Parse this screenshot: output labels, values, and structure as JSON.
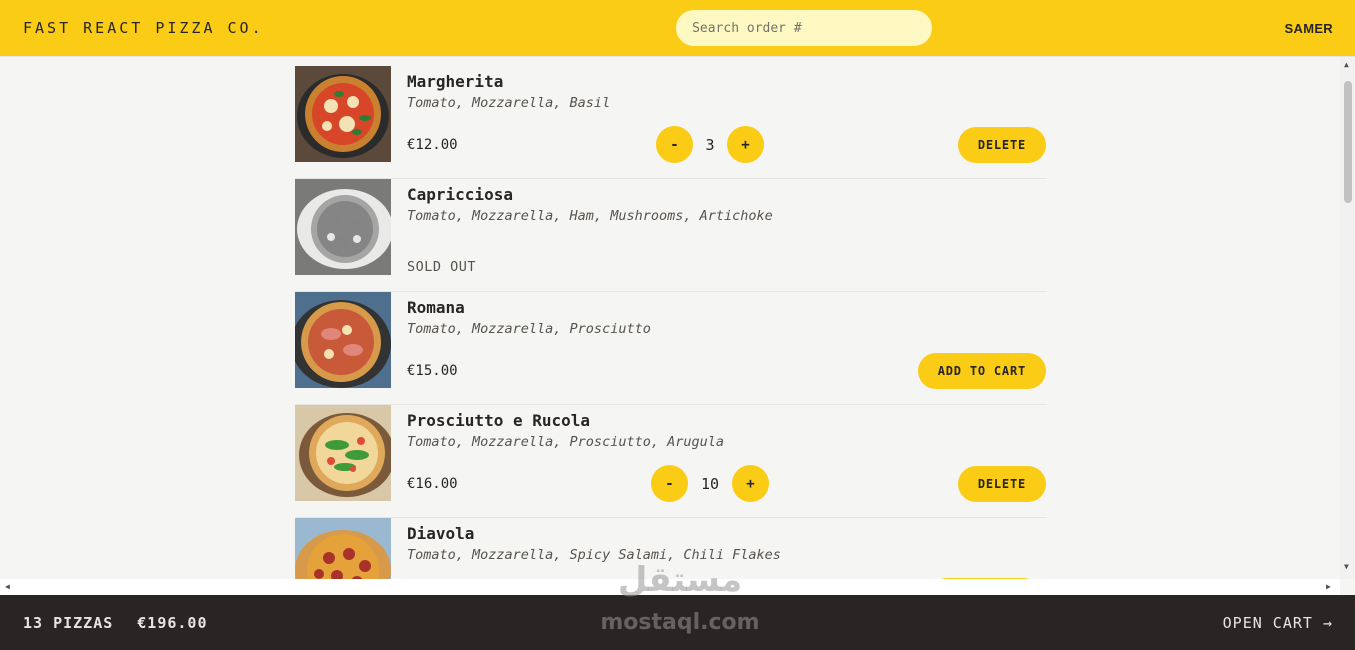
{
  "header": {
    "logo": "Fast React Pizza Co.",
    "search_placeholder": "Search order #",
    "username": "SAMER"
  },
  "menu": [
    {
      "name": "Margherita",
      "ingredients": "Tomato, Mozzarella, Basil",
      "price": "€12.00",
      "quantity": "3",
      "decrease_label": "-",
      "increase_label": "+",
      "action_label": "Delete",
      "sold_out": false
    },
    {
      "name": "Capricciosa",
      "ingredients": "Tomato, Mozzarella, Ham, Mushrooms, Artichoke",
      "status": "Sold out",
      "sold_out": true
    },
    {
      "name": "Romana",
      "ingredients": "Tomato, Mozzarella, Prosciutto",
      "price": "€15.00",
      "action_label": "Add to cart",
      "sold_out": false
    },
    {
      "name": "Prosciutto e Rucola",
      "ingredients": "Tomato, Mozzarella, Prosciutto, Arugula",
      "price": "€16.00",
      "quantity": "10",
      "decrease_label": "-",
      "increase_label": "+",
      "action_label": "Delete",
      "sold_out": false
    },
    {
      "name": "Diavola",
      "ingredients": "Tomato, Mozzarella, Spicy Salami, Chili Flakes",
      "sold_out": false
    }
  ],
  "footer": {
    "pizza_count": "13 pizzas",
    "total": "€196.00",
    "open_cart": "Open cart →"
  },
  "watermark": {
    "arabic": "مستقل",
    "latin": "mostaql.com"
  },
  "colors": {
    "brand_yellow": "#facc15",
    "search_bg": "#fef9c3",
    "footer_bg": "#292524",
    "page_bg": "#f5f5f4"
  }
}
